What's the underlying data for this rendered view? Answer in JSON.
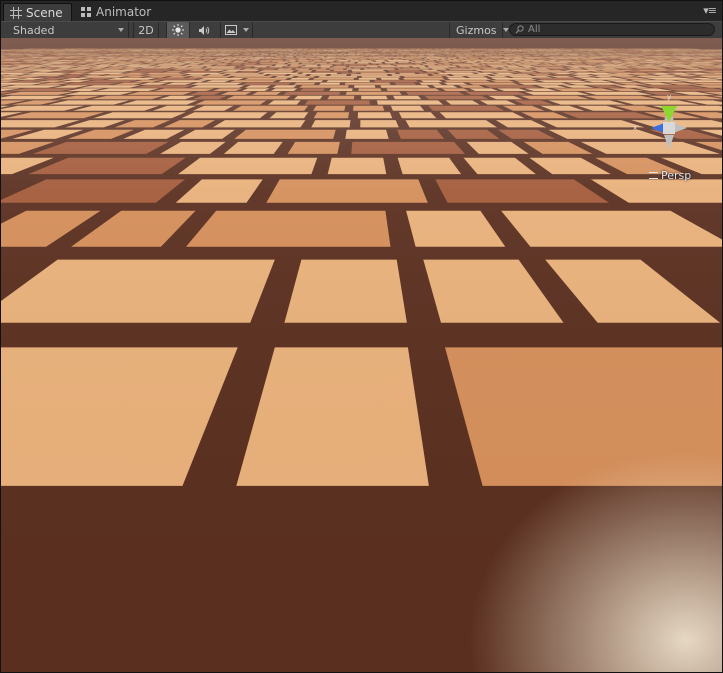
{
  "tabs": [
    {
      "label": "Scene",
      "icon": "grid-icon",
      "active": true
    },
    {
      "label": "Animator",
      "icon": "animator-icon",
      "active": false
    }
  ],
  "toolbar": {
    "shading_mode": "Shaded",
    "mode_2d_label": "2D",
    "lighting_icon": "sun-icon",
    "audio_icon": "speaker-icon",
    "effects_icon": "image-icon",
    "gizmos_label": "Gizmos",
    "search_placeholder": "All"
  },
  "viewport": {
    "projection_label": "Persp",
    "floor_colors": {
      "light": "#e8b07a",
      "mid": "#d48e5a",
      "dark": "#a35a3a",
      "grout": "#5a2f1f"
    },
    "gizmo_colors": {
      "y_axis": "#8ed630",
      "x_axis": "#3b6fe0",
      "center": "#d8d8d8",
      "other": "#bfbfbf"
    }
  }
}
